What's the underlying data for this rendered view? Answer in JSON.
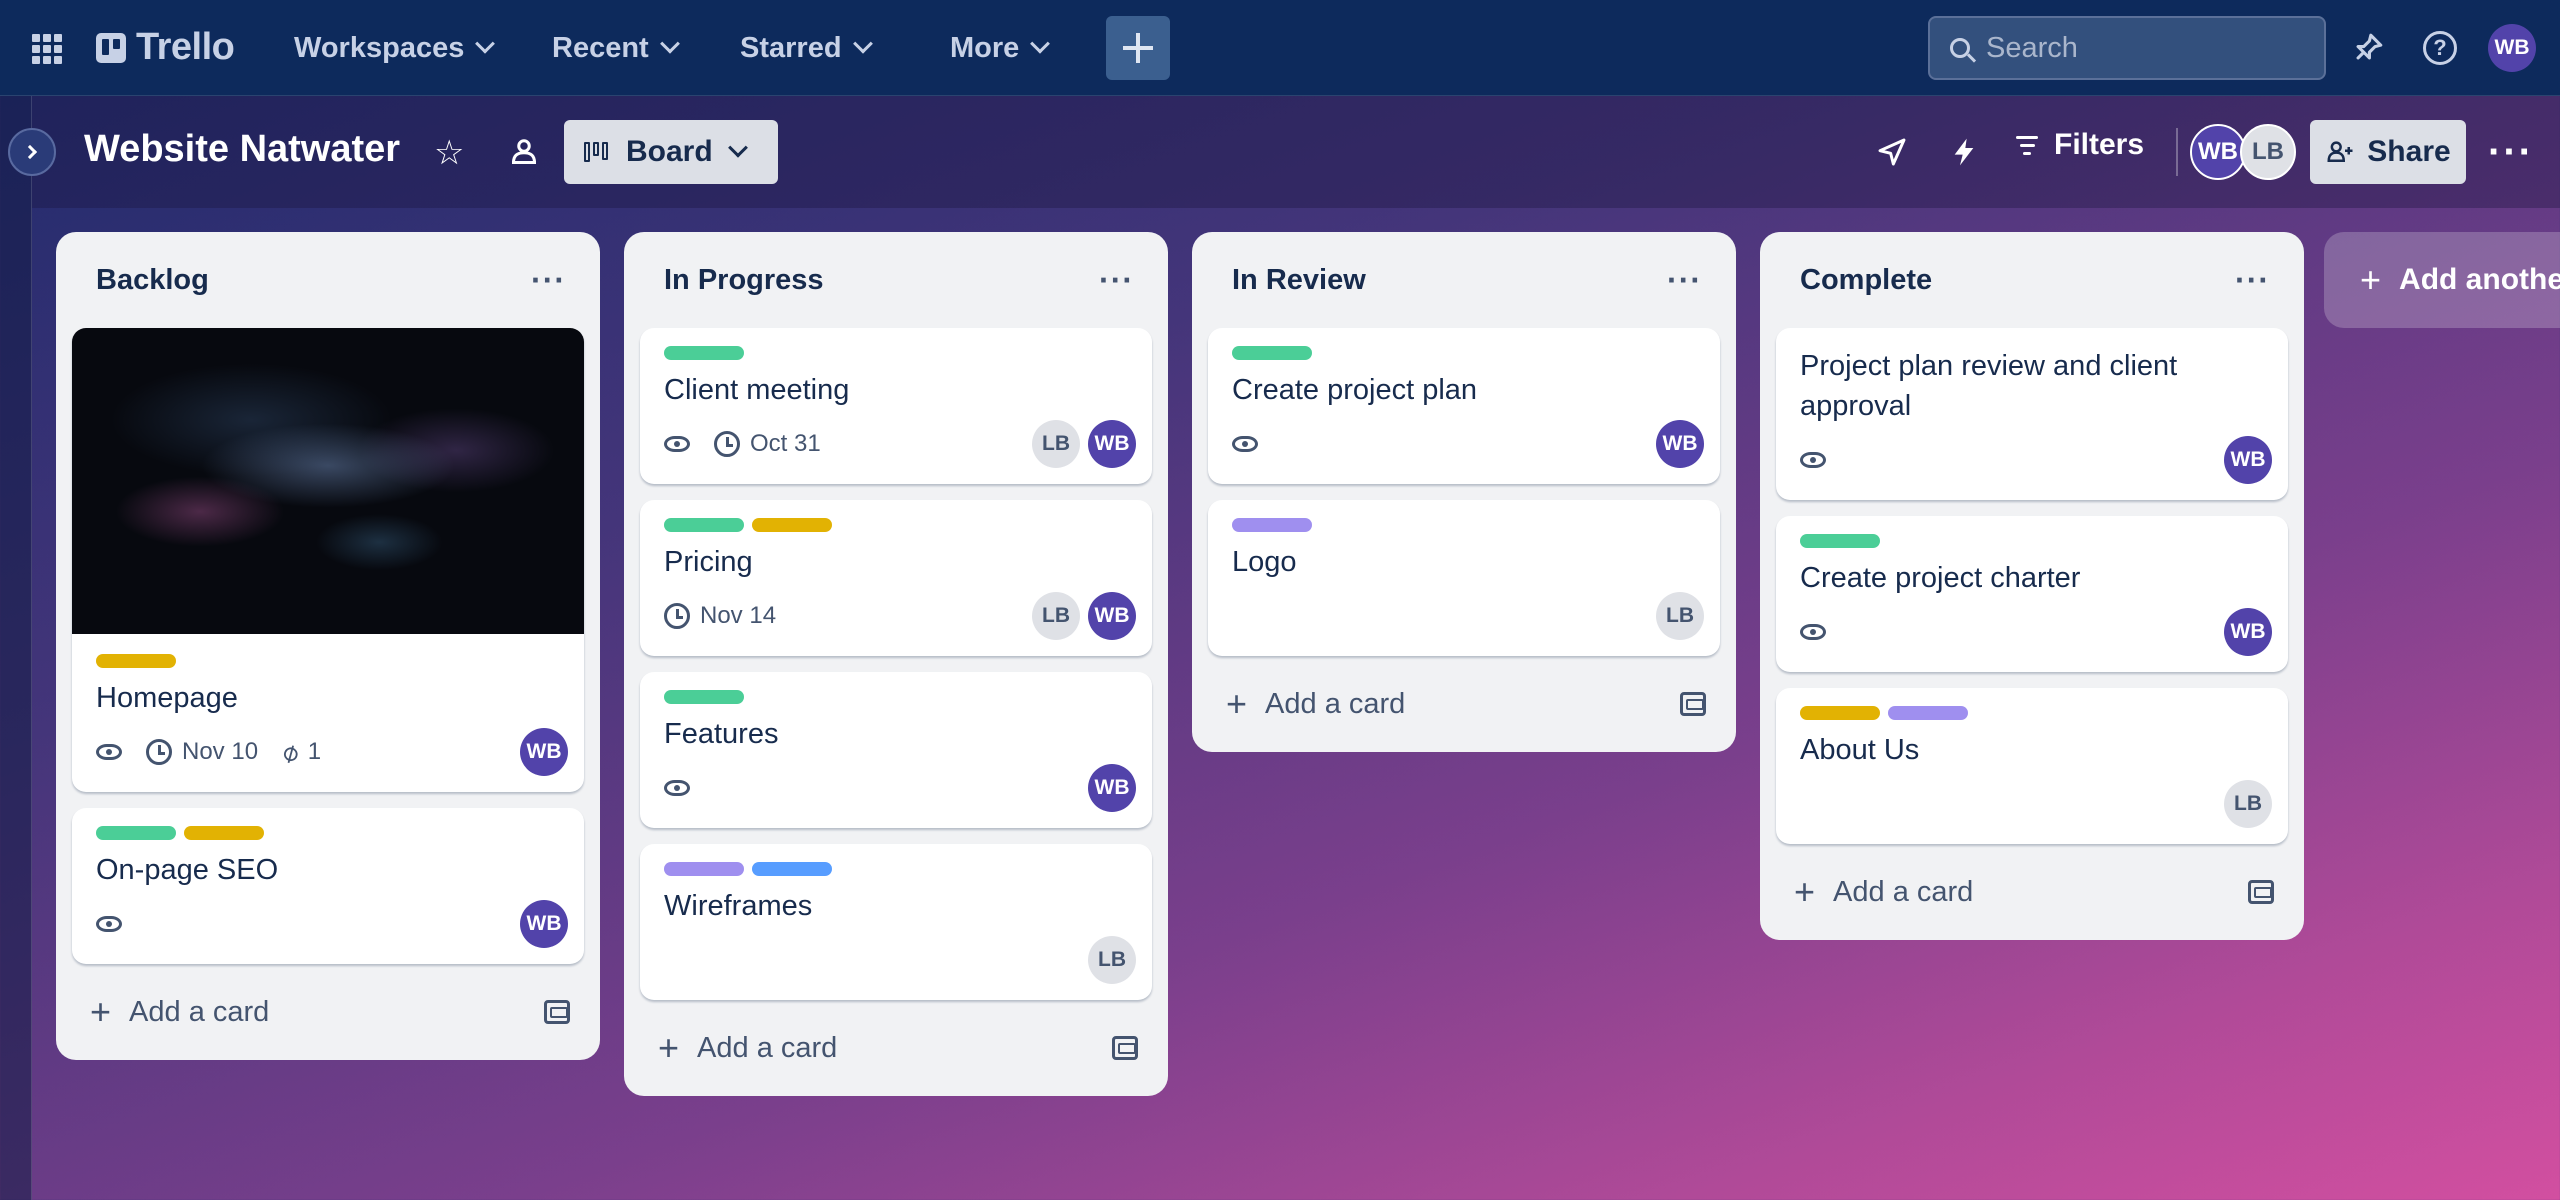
{
  "nav": {
    "app_name": "Trello",
    "items": [
      "Workspaces",
      "Recent",
      "Starred",
      "More"
    ],
    "search_placeholder": "Search",
    "user_initials": "WB"
  },
  "board": {
    "title": "Website Natwater",
    "view_label": "Board",
    "filters_label": "Filters",
    "share_label": "Share",
    "members": [
      "WB",
      "LB"
    ],
    "add_list_label": "Add another list"
  },
  "colors": {
    "green": "#4bce97",
    "yellow": "#e2b203",
    "purple": "#9f8fef",
    "blue": "#579dff"
  },
  "lists": [
    {
      "title": "Backlog",
      "add_label": "Add a card",
      "cards": [
        {
          "title": "Homepage",
          "cover": true,
          "labels": [
            "yellow"
          ],
          "watch": true,
          "due": "Nov 10",
          "attachments": "1",
          "members": [
            "WB"
          ]
        },
        {
          "title": "On-page SEO",
          "labels": [
            "green",
            "yellow"
          ],
          "watch": true,
          "members": [
            "WB"
          ]
        }
      ]
    },
    {
      "title": "In Progress",
      "add_label": "Add a card",
      "cards": [
        {
          "title": "Client meeting",
          "labels": [
            "green"
          ],
          "watch": true,
          "due": "Oct 31",
          "members": [
            "LB",
            "WB"
          ]
        },
        {
          "title": "Pricing",
          "labels": [
            "green",
            "yellow"
          ],
          "due": "Nov 14",
          "members": [
            "LB",
            "WB"
          ]
        },
        {
          "title": "Features",
          "labels": [
            "green"
          ],
          "watch": true,
          "members": [
            "WB"
          ]
        },
        {
          "title": "Wireframes",
          "labels": [
            "purple",
            "blue"
          ],
          "members": [
            "LB"
          ]
        }
      ]
    },
    {
      "title": "In Review",
      "add_label": "Add a card",
      "cards": [
        {
          "title": "Create project plan",
          "labels": [
            "green"
          ],
          "watch": true,
          "members": [
            "WB"
          ]
        },
        {
          "title": "Logo",
          "labels": [
            "purple"
          ],
          "members": [
            "LB"
          ]
        }
      ]
    },
    {
      "title": "Complete",
      "add_label": "Add a card",
      "cards": [
        {
          "title": "Project plan review and client approval",
          "labels": [],
          "watch": true,
          "members": [
            "WB"
          ]
        },
        {
          "title": "Create project charter",
          "labels": [
            "green"
          ],
          "watch": true,
          "members": [
            "WB"
          ]
        },
        {
          "title": "About Us",
          "labels": [
            "yellow",
            "purple"
          ],
          "members": [
            "LB"
          ]
        }
      ]
    }
  ]
}
